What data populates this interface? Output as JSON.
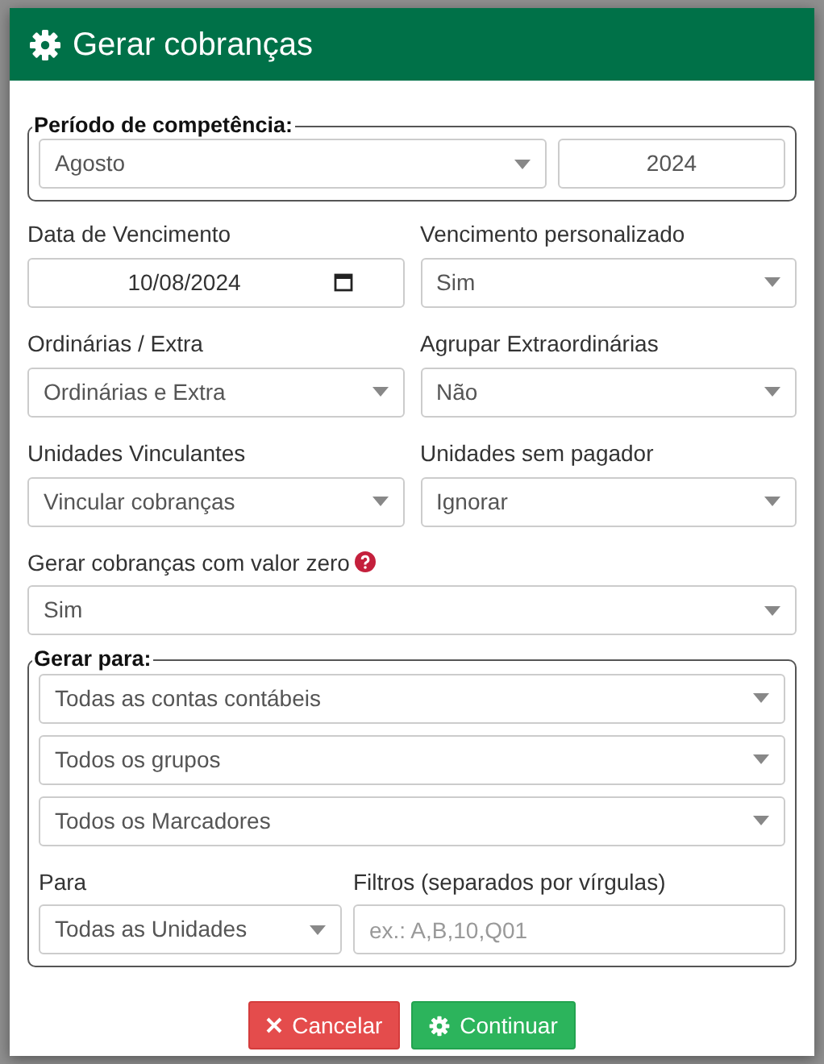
{
  "dialog": {
    "title": "Gerar cobranças"
  },
  "period": {
    "legend": "Período de competência:",
    "month": "Agosto",
    "year": "2024"
  },
  "fields": [
    {
      "label": "Data de Vencimento",
      "kind": "date",
      "value": "10/08/2024"
    },
    {
      "label": "Vencimento personalizado",
      "kind": "select",
      "value": "Sim"
    },
    {
      "label": "Ordinárias / Extra",
      "kind": "select",
      "value": "Ordinárias e Extra"
    },
    {
      "label": "Agrupar Extraordinárias",
      "kind": "select",
      "value": "Não"
    },
    {
      "label": "Unidades Vinculantes",
      "kind": "select",
      "value": "Vincular cobranças"
    },
    {
      "label": "Unidades sem pagador",
      "kind": "select",
      "value": "Ignorar"
    }
  ],
  "zero_field": {
    "label": "Gerar cobranças com valor zero",
    "value": "Sim"
  },
  "generate_for": {
    "legend": "Gerar para:",
    "selects": [
      "Todas as contas contábeis",
      "Todos os grupos",
      "Todos os Marcadores"
    ],
    "para": {
      "label": "Para",
      "value": "Todas as Unidades"
    },
    "filters": {
      "label": "Filtros (separados por vírgulas)",
      "placeholder": "ex.: A,B,10,Q01"
    }
  },
  "buttons": [
    {
      "label": "Cancelar",
      "kind": "cancel"
    },
    {
      "label": "Continuar",
      "kind": "continue"
    }
  ]
}
